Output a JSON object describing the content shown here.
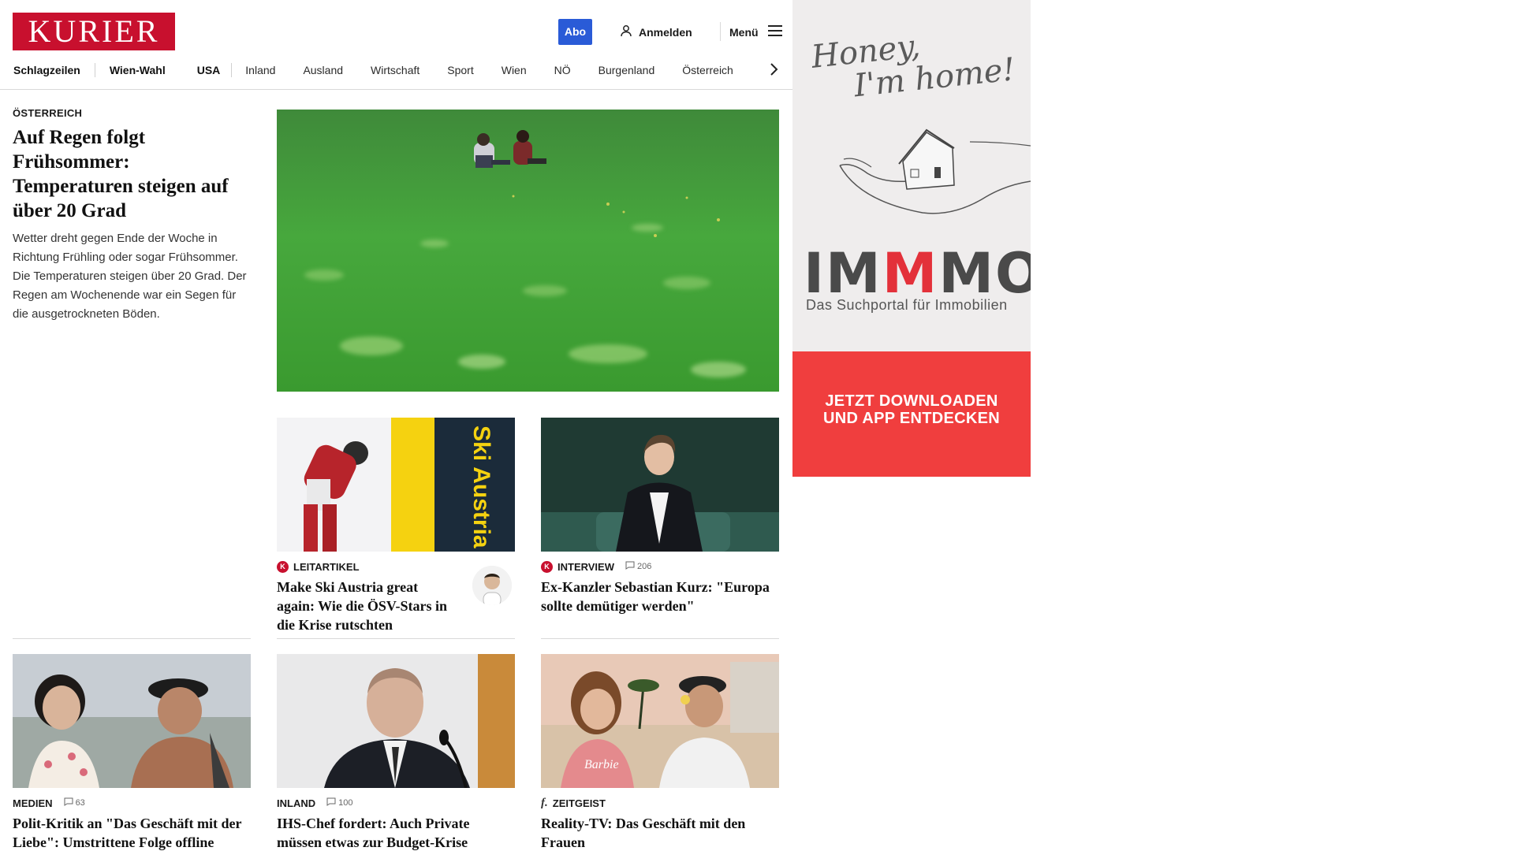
{
  "header": {
    "logo_text": "KURIER",
    "abo_label": "Abo",
    "login_label": "Anmelden",
    "menu_label": "Menü",
    "nav": [
      {
        "label": "Schlagzeilen",
        "bold": true
      },
      {
        "label": "Wien-Wahl",
        "bold": true
      },
      {
        "label": "USA",
        "bold": true
      },
      {
        "label": "Inland",
        "bold": false
      },
      {
        "label": "Ausland",
        "bold": false
      },
      {
        "label": "Wirtschaft",
        "bold": false
      },
      {
        "label": "Sport",
        "bold": false
      },
      {
        "label": "Wien",
        "bold": false
      },
      {
        "label": "NÖ",
        "bold": false
      },
      {
        "label": "Burgenland",
        "bold": false
      },
      {
        "label": "Österreich",
        "bold": false
      }
    ]
  },
  "lead": {
    "kicker": "ÖSTERREICH",
    "title": "Auf Regen folgt Frühsommer: Temperaturen steigen auf über 20 Grad",
    "teaser": "Wetter dreht gegen Ende der Woche in Richtung Frühling oder sogar Frühsommer. Die Temperaturen steigen über 20 Grad. Der Regen am Wochenende war ein Segen für die ausgetrockneten Böden."
  },
  "cards": {
    "ski": {
      "badge": "K",
      "kicker": "LEITARTIKEL",
      "title": "Make Ski Austria great again: Wie die ÖSV-Stars in die Krise rutschten",
      "image_text": "Ski Austria"
    },
    "kurz": {
      "badge": "K",
      "kicker": "INTERVIEW",
      "comments": "206",
      "title": "Ex-Kanzler Sebastian Kurz: \"Europa sollte demütiger werden\""
    },
    "medien": {
      "kicker": "MEDIEN",
      "comments": "63",
      "title": "Polit-Kritik an \"Das Geschäft mit der Liebe\": Umstrittene Folge offline genommen"
    },
    "ihs": {
      "kicker": "INLAND",
      "comments": "100",
      "title": "IHS-Chef fordert: Auch Private müssen etwas zur Budget-Krise beitragen"
    },
    "reality": {
      "badge": "f.",
      "kicker": "ZEITGEIST",
      "title": "Reality-TV: Das Geschäft mit den Frauen",
      "shirt_text": "Barbie"
    }
  },
  "ad": {
    "script_line1": "Honey,",
    "script_line2": "I'm home!",
    "brand_a": "IM",
    "brand_b": "M",
    "brand_c": "MO",
    "tagline": "Das Suchportal für Immobilien",
    "cta_line1": "JETZT DOWNLOADEN",
    "cta_line2": "UND APP ENTDECKEN",
    "colors": {
      "cta_bg": "#f03e3e",
      "brand_accent": "#e3313a"
    }
  },
  "colors": {
    "brand": "#c8102e",
    "abo": "#2a5bd7"
  }
}
